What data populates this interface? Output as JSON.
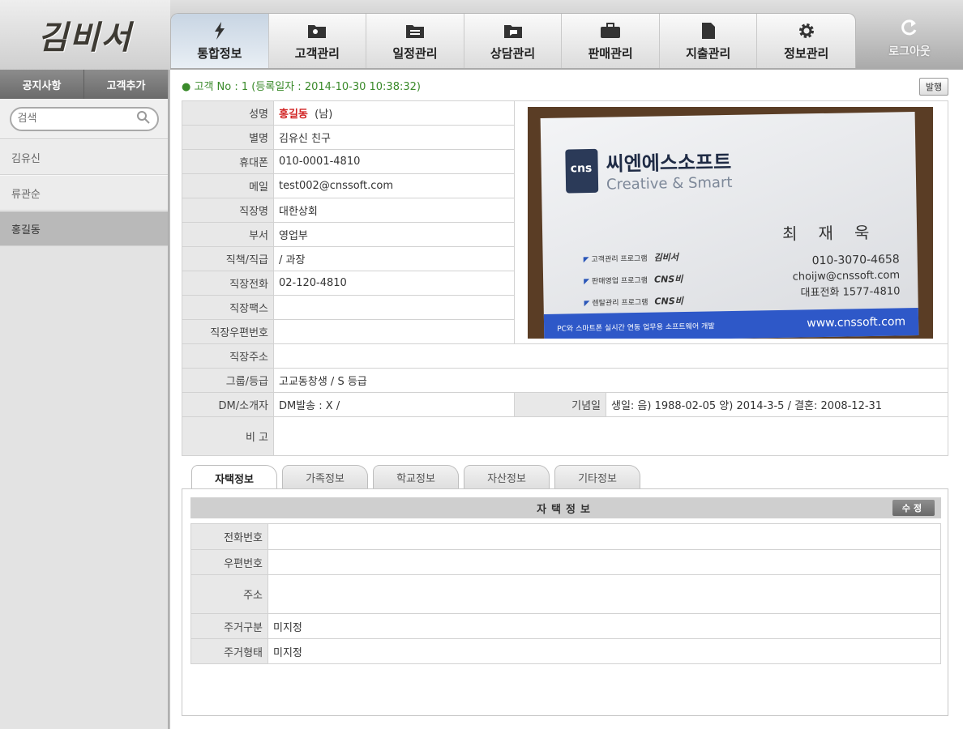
{
  "app": {
    "logo_text": "김비서"
  },
  "nav": {
    "tabs": [
      {
        "label": "통합정보",
        "icon": "lightning-icon",
        "active": true
      },
      {
        "label": "고객관리",
        "icon": "customer-folder-icon",
        "active": false
      },
      {
        "label": "일정관리",
        "icon": "calendar-folder-icon",
        "active": false
      },
      {
        "label": "상담관리",
        "icon": "consult-folder-icon",
        "active": false
      },
      {
        "label": "판매관리",
        "icon": "briefcase-icon",
        "active": false
      },
      {
        "label": "지출관리",
        "icon": "document-icon",
        "active": false
      },
      {
        "label": "정보관리",
        "icon": "gear-icon",
        "active": false
      }
    ],
    "logout_label": "로그아웃"
  },
  "sidebar": {
    "notice_label": "공지사항",
    "add_customer_label": "고객추가",
    "search_placeholder": "검색",
    "customers": [
      "김유신",
      "류관순",
      "홍길동"
    ],
    "selected": "홍길동"
  },
  "customer": {
    "info_line": "고객 No : 1 (등록일자 : 2014-10-30 10:38:32)",
    "issue_button": "발행",
    "fields": {
      "name_label": "성명",
      "name": "홍길동",
      "name_suffix": "(남)",
      "nickname_label": "별명",
      "nickname": "김유신 친구",
      "mobile_label": "휴대폰",
      "mobile": "010-0001-4810",
      "email_label": "메일",
      "email": "test002@cnssoft.com",
      "company_label": "직장명",
      "company": "대한상회",
      "dept_label": "부서",
      "dept": "영업부",
      "title_label": "직책/직급",
      "title": "/ 과장",
      "work_phone_label": "직장전화",
      "work_phone": "02-120-4810",
      "work_fax_label": "직장팩스",
      "work_fax": "",
      "work_zip_label": "직장우편번호",
      "work_zip": "",
      "work_addr_label": "직장주소",
      "work_addr": "",
      "group_label": "그룹/등급",
      "group": "고교동창생   /   S 등급",
      "dm_label": "DM/소개자",
      "dm": "DM발송 : X /",
      "anniv_label": "기념일",
      "anniv": "생일: 음) 1988-02-05 양) 2014-3-5 / 결혼: 2008-12-31",
      "memo_label": "비 고",
      "memo": ""
    },
    "card": {
      "company_ko": "씨엔에스소프트",
      "company_en": "Creative & Smart",
      "logo_mark": "cns",
      "person": "최재욱",
      "phone": "010-3070-4658",
      "email": "choijw@cnssoft.com",
      "main_phone": "대표전화 1577-4810",
      "products": [
        "고객관리 프로그램",
        "판매영업 프로그램",
        "렌탈관리 프로그램"
      ],
      "product_names": [
        "김비서",
        "CNS비",
        "CNS비"
      ],
      "bar_text": "PC와 스마트폰 실시간 연동 업무용 소프트웨어 개발",
      "url": "www.cnssoft.com"
    }
  },
  "subtabs": [
    "자택정보",
    "가족정보",
    "학교정보",
    "자산정보",
    "기타정보"
  ],
  "home": {
    "header": "자택정보",
    "edit_button": "수정",
    "rows": [
      {
        "label": "전화번호",
        "value": ""
      },
      {
        "label": "우편번호",
        "value": ""
      },
      {
        "label": "주소",
        "value": ""
      },
      {
        "label": "주거구분",
        "value": "미지정"
      },
      {
        "label": "주거형태",
        "value": "미지정"
      }
    ]
  }
}
